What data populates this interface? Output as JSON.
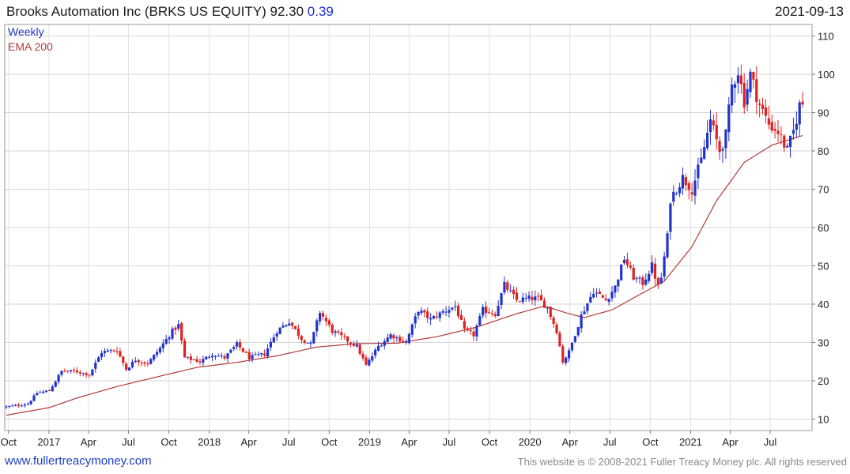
{
  "header": {
    "name": "Brooks Automation Inc (BRKS US EQUITY)",
    "price": "92.30",
    "change": "0.39",
    "date": "2021-09-13"
  },
  "legend": {
    "period": "Weekly",
    "indicator": "EMA 200"
  },
  "footer": {
    "site": "www.fullertreacymoney.com",
    "copyright": "This website is © 2008-2021 Fuller Treacy Money plc. All rights reserved"
  },
  "colors": {
    "up": "#2233cc",
    "down": "#dd2222",
    "ema": "#b23a3a",
    "grid": "#d6d6d6",
    "text": "#222222"
  },
  "chart_data": {
    "type": "candlestick",
    "interval": "weekly",
    "y_axis": {
      "side": "right",
      "ticks": [
        10,
        20,
        30,
        40,
        50,
        60,
        70,
        80,
        90,
        100,
        110
      ],
      "ylim": [
        7,
        113
      ]
    },
    "x_axis": {
      "range": [
        "2016-09-26",
        "2021-09-20"
      ],
      "tick_labels": [
        "Oct",
        "2017",
        "Apr",
        "Jul",
        "Oct",
        "2018",
        "Apr",
        "Jul",
        "Oct",
        "2019",
        "Apr",
        "Jul",
        "Oct",
        "2020",
        "Apr",
        "Jul",
        "Oct",
        "2021",
        "Apr",
        "Jul"
      ],
      "tick_dates": [
        "2016-10-01",
        "2017-01-01",
        "2017-04-01",
        "2017-07-01",
        "2017-10-01",
        "2018-01-01",
        "2018-04-01",
        "2018-07-01",
        "2018-10-01",
        "2019-01-01",
        "2019-04-01",
        "2019-07-01",
        "2019-10-01",
        "2020-01-01",
        "2020-04-01",
        "2020-07-01",
        "2020-10-01",
        "2021-01-01",
        "2021-04-01",
        "2021-07-01"
      ]
    },
    "grid": true,
    "price_anchors": [
      [
        "2016-09-26",
        13.2
      ],
      [
        "2016-10-24",
        13.6
      ],
      [
        "2016-11-14",
        14.0
      ],
      [
        "2016-12-05",
        16.8
      ],
      [
        "2017-01-02",
        17.4
      ],
      [
        "2017-01-30",
        22.5
      ],
      [
        "2017-03-06",
        22.4
      ],
      [
        "2017-04-03",
        21.6
      ],
      [
        "2017-05-01",
        27.5
      ],
      [
        "2017-06-05",
        28.0
      ],
      [
        "2017-06-26",
        23.0
      ],
      [
        "2017-07-17",
        25.5
      ],
      [
        "2017-08-14",
        24.5
      ],
      [
        "2017-09-11",
        28.5
      ],
      [
        "2017-10-09",
        33.0
      ],
      [
        "2017-10-23",
        34.5
      ],
      [
        "2017-11-06",
        26.0
      ],
      [
        "2017-12-11",
        25.0
      ],
      [
        "2018-01-08",
        27.0
      ],
      [
        "2018-02-05",
        26.0
      ],
      [
        "2018-03-05",
        29.5
      ],
      [
        "2018-04-02",
        26.0
      ],
      [
        "2018-05-07",
        27.0
      ],
      [
        "2018-06-04",
        33.0
      ],
      [
        "2018-07-02",
        35.5
      ],
      [
        "2018-07-30",
        31.0
      ],
      [
        "2018-08-20",
        29.5
      ],
      [
        "2018-09-10",
        38.0
      ],
      [
        "2018-10-08",
        33.0
      ],
      [
        "2018-11-05",
        31.0
      ],
      [
        "2018-12-03",
        29.0
      ],
      [
        "2018-12-24",
        24.0
      ],
      [
        "2019-01-21",
        29.0
      ],
      [
        "2019-02-18",
        32.0
      ],
      [
        "2019-03-25",
        30.0
      ],
      [
        "2019-04-22",
        38.5
      ],
      [
        "2019-05-20",
        36.0
      ],
      [
        "2019-06-17",
        38.0
      ],
      [
        "2019-07-15",
        39.5
      ],
      [
        "2019-08-05",
        33.0
      ],
      [
        "2019-08-26",
        32.0
      ],
      [
        "2019-09-16",
        38.5
      ],
      [
        "2019-10-14",
        37.5
      ],
      [
        "2019-11-04",
        45.0
      ],
      [
        "2019-12-02",
        41.0
      ],
      [
        "2019-12-30",
        41.5
      ],
      [
        "2020-01-20",
        41.5
      ],
      [
        "2020-02-10",
        39.0
      ],
      [
        "2020-03-02",
        33.0
      ],
      [
        "2020-03-16",
        25.0
      ],
      [
        "2020-03-30",
        27.5
      ],
      [
        "2020-04-27",
        37.0
      ],
      [
        "2020-05-25",
        43.5
      ],
      [
        "2020-06-22",
        41.0
      ],
      [
        "2020-07-13",
        44.5
      ],
      [
        "2020-08-03",
        52.0
      ],
      [
        "2020-08-24",
        47.0
      ],
      [
        "2020-09-14",
        45.5
      ],
      [
        "2020-10-05",
        50.0
      ],
      [
        "2020-10-19",
        44.5
      ],
      [
        "2020-10-26",
        47.0
      ],
      [
        "2020-11-09",
        57.5
      ],
      [
        "2020-11-16",
        67.5
      ],
      [
        "2020-12-14",
        73.0
      ],
      [
        "2021-01-04",
        70.0
      ],
      [
        "2021-01-25",
        77.5
      ],
      [
        "2021-02-15",
        88.0
      ],
      [
        "2021-03-08",
        80.0
      ],
      [
        "2021-03-22",
        84.0
      ],
      [
        "2021-04-05",
        97.0
      ],
      [
        "2021-04-19",
        101.0
      ],
      [
        "2021-05-03",
        93.0
      ],
      [
        "2021-05-17",
        100.0
      ],
      [
        "2021-06-07",
        92.0
      ],
      [
        "2021-06-28",
        87.0
      ],
      [
        "2021-07-19",
        85.0
      ],
      [
        "2021-08-09",
        80.0
      ],
      [
        "2021-08-23",
        85.0
      ],
      [
        "2021-09-06",
        91.9
      ],
      [
        "2021-09-13",
        92.3
      ]
    ],
    "ema200_anchors": [
      [
        "2016-09-26",
        11.0
      ],
      [
        "2017-01-02",
        13.0
      ],
      [
        "2017-03-06",
        15.5
      ],
      [
        "2017-06-05",
        18.5
      ],
      [
        "2017-09-04",
        21.0
      ],
      [
        "2017-12-04",
        23.5
      ],
      [
        "2018-03-05",
        24.8
      ],
      [
        "2018-06-04",
        26.5
      ],
      [
        "2018-09-03",
        28.8
      ],
      [
        "2018-12-03",
        29.7
      ],
      [
        "2019-03-04",
        29.8
      ],
      [
        "2019-06-03",
        31.5
      ],
      [
        "2019-09-02",
        34.0
      ],
      [
        "2019-12-02",
        37.5
      ],
      [
        "2020-02-03",
        39.5
      ],
      [
        "2020-03-30",
        37.5
      ],
      [
        "2020-05-04",
        36.5
      ],
      [
        "2020-07-06",
        38.5
      ],
      [
        "2020-09-07",
        42.5
      ],
      [
        "2020-11-02",
        46.0
      ],
      [
        "2021-01-04",
        55.0
      ],
      [
        "2021-03-01",
        67.0
      ],
      [
        "2021-05-03",
        77.0
      ],
      [
        "2021-07-05",
        81.5
      ],
      [
        "2021-09-13",
        84.0
      ]
    ]
  }
}
